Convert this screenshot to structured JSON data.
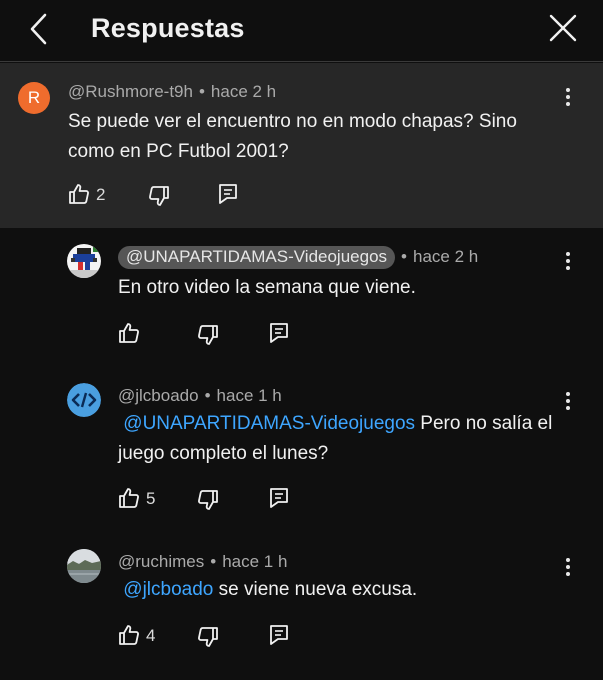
{
  "header": {
    "title": "Respuestas"
  },
  "parent_comment": {
    "avatar_letter": "R",
    "author": "@Rushmore-t9h",
    "separator": "•",
    "time": "hace 2 h",
    "text": "Se puede ver el encuentro no en modo chapas? Sino como en PC Futbol 2001?",
    "likes": "2"
  },
  "replies": [
    {
      "author": "@UNAPARTIDAMAS-Videojuegos",
      "separator": "•",
      "time": "hace 2 h",
      "text": "En otro video la semana que viene.",
      "likes": ""
    },
    {
      "author": "@jlcboado",
      "separator": "•",
      "time": "hace 1 h",
      "mention": "@UNAPARTIDAMAS-Videojuegos",
      "text": " Pero no salía el juego completo el lunes?",
      "likes": "5"
    },
    {
      "author": "@ruchimes",
      "separator": "•",
      "time": "hace 1 h",
      "mention": "@jlcboado",
      "text": " se viene nueva excusa.",
      "likes": "4"
    }
  ],
  "colors": {
    "background": "#0f0f0f",
    "highlight": "#272727",
    "mention": "#3ea6ff",
    "avatar_r": "#ef6c2d"
  },
  "icons": [
    "back-arrow-icon",
    "close-icon",
    "thumb-up-icon",
    "thumb-down-icon",
    "reply-icon",
    "more-vert-icon"
  ]
}
